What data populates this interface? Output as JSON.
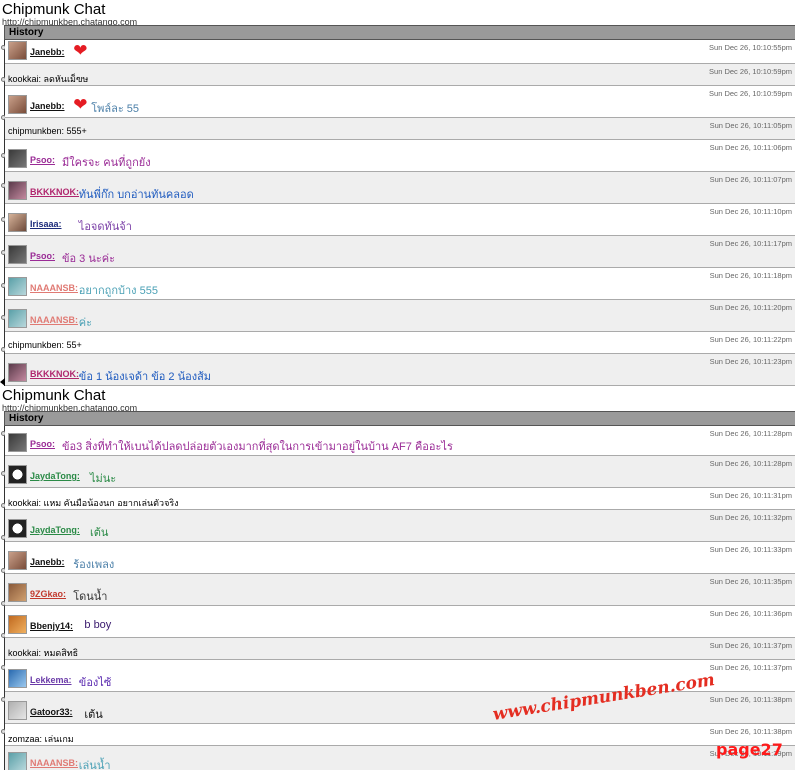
{
  "panel1": {
    "title": "Chipmunk Chat",
    "url": "http://chipmunkben.chatango.com",
    "history_label": "History",
    "messages": [
      {
        "type": "user",
        "name": "Janebb:",
        "name_color": "#111111",
        "text": "",
        "text_color": "#4b7fa8",
        "heart": true,
        "timestamp": "Sun Dec 26, 10:10:55pm",
        "avatar": "woman"
      },
      {
        "type": "anon",
        "text": "kookkai: ลดหันเม็ฃษ",
        "timestamp": "Sun Dec 26, 10:10:59pm"
      },
      {
        "type": "user",
        "name": "Janebb:",
        "name_color": "#111111",
        "text": "โพล์ละ 55",
        "text_color": "#4b7fa8",
        "heart": true,
        "timestamp": "Sun Dec 26, 10:10:59pm",
        "avatar": "woman"
      },
      {
        "type": "anon",
        "text": "chipmunkben: 555+",
        "timestamp": "Sun Dec 26, 10:11:05pm"
      },
      {
        "type": "user",
        "name": "Psoo:",
        "name_color": "#9a2b96",
        "text": "มีใครจะ คนที่ถูกยัง",
        "text_color": "#9a2b96",
        "heart": false,
        "timestamp": "Sun Dec 26, 10:11:06pm",
        "avatar": "dark"
      },
      {
        "type": "user",
        "name": "BKKKNOK:",
        "name_color": "#b0266e",
        "text": "ทันพี่ก๊ก บกอ่านทันคลอด",
        "text_color": "#1f5bbf",
        "heart": false,
        "timestamp": "Sun Dec 26, 10:11:07pm",
        "avatar": "couple"
      },
      {
        "type": "user",
        "name": "Irisaaa:",
        "name_color": "#1b2a7a",
        "text": "ไอจดทันจ้า",
        "text_color": "#7a3fa6",
        "heart": false,
        "timestamp": "Sun Dec 26, 10:11:10pm",
        "avatar": "girl"
      },
      {
        "type": "user",
        "name": "Psoo:",
        "name_color": "#9a2b96",
        "text": "ข้อ 3 นะค่ะ",
        "text_color": "#9a2b96",
        "heart": false,
        "timestamp": "Sun Dec 26, 10:11:17pm",
        "avatar": "dark"
      },
      {
        "type": "user",
        "name": "NAAANSB:",
        "name_color": "#e07a74",
        "text": "อยากถูกบ้าง 555",
        "text_color": "#4aa0b5",
        "heart": false,
        "timestamp": "Sun Dec 26, 10:11:18pm",
        "avatar": "teal"
      },
      {
        "type": "user",
        "name": "NAAANSB:",
        "name_color": "#e07a74",
        "text": "ค่ะ",
        "text_color": "#4aa0b5",
        "heart": false,
        "timestamp": "Sun Dec 26, 10:11:20pm",
        "avatar": "teal"
      },
      {
        "type": "anon",
        "text": "chipmunkben: 55+",
        "timestamp": "Sun Dec 26, 10:11:22pm"
      },
      {
        "type": "user",
        "name": "BKKKNOK:",
        "name_color": "#b0266e",
        "text": "ข้อ 1 น้องเจด้า ข้อ 2 น้องส้ม",
        "text_color": "#1f5bbf",
        "heart": false,
        "timestamp": "Sun Dec 26, 10:11:23pm",
        "avatar": "couple"
      }
    ]
  },
  "panel2": {
    "title": "Chipmunk Chat",
    "url": "http://chipmunkben.chatango.com",
    "history_label": "History",
    "messages": [
      {
        "type": "user",
        "name": "Psoo:",
        "name_color": "#9a2b96",
        "text": "ข้อ3 สิ่งที่ทำให้เบนได้ปลดปล่อยตัวเองมากที่สุดในการเข้ามาอยู่ในบ้าน AF7 คืออะไร",
        "text_color": "#9a2b96",
        "heart": false,
        "timestamp": "Sun Dec 26, 10:11:28pm",
        "avatar": "dark"
      },
      {
        "type": "user",
        "name": "JaydaTong:",
        "name_color": "#2a8a46",
        "text": "ไม่นะ",
        "text_color": "#2a8a46",
        "heart": false,
        "timestamp": "Sun Dec 26, 10:11:28pm",
        "avatar": "panda"
      },
      {
        "type": "anon",
        "text": "kookkai: แหม คันมือน้องนก อยากเล่นตัวจริง",
        "timestamp": "Sun Dec 26, 10:11:31pm"
      },
      {
        "type": "user",
        "name": "JaydaTong:",
        "name_color": "#2a8a46",
        "text": "เต้น",
        "text_color": "#2a8a46",
        "heart": false,
        "timestamp": "Sun Dec 26, 10:11:32pm",
        "avatar": "panda"
      },
      {
        "type": "user",
        "name": "Janebb:",
        "name_color": "#111111",
        "text": "ร้องเพลง",
        "text_color": "#4b7fa8",
        "heart": false,
        "timestamp": "Sun Dec 26, 10:11:33pm",
        "avatar": "woman"
      },
      {
        "type": "user",
        "name": "9ZGkao:",
        "name_color": "#c23a2e",
        "text": "โดนน้ำ",
        "text_color": "#333333",
        "heart": false,
        "timestamp": "Sun Dec 26, 10:11:35pm",
        "avatar": "brown"
      },
      {
        "type": "user",
        "name": "Bbenjy14:",
        "name_color": "#111111",
        "text": "b boy",
        "text_color": "#3a1a6e",
        "heart": false,
        "timestamp": "Sun Dec 26, 10:11:36pm",
        "avatar": "orange"
      },
      {
        "type": "anon",
        "text": "kookkai: หมดสิทธิ",
        "timestamp": "Sun Dec 26, 10:11:37pm"
      },
      {
        "type": "user",
        "name": "Lekkema:",
        "name_color": "#6a3aa8",
        "text": "ข้องไซ้",
        "text_color": "#5a2ab0",
        "heart": false,
        "timestamp": "Sun Dec 26, 10:11:37pm",
        "avatar": "blue"
      },
      {
        "type": "user",
        "name": "Gatoor33:",
        "name_color": "#111111",
        "text": "เต้น",
        "text_color": "#111111",
        "heart": false,
        "timestamp": "Sun Dec 26, 10:11:38pm",
        "avatar": "gray"
      },
      {
        "type": "anon",
        "text": "zomzaa: เล่นเกม",
        "timestamp": "Sun Dec 26, 10:11:38pm"
      },
      {
        "type": "user",
        "name": "NAAANSB:",
        "name_color": "#e07a74",
        "text": "เล่นน้ำ",
        "text_color": "#4aa0b5",
        "heart": false,
        "timestamp": "Sun Dec 26, 10:11:39pm",
        "avatar": "teal"
      }
    ]
  },
  "watermark": {
    "site": "www.chipmunkben.com",
    "page": "page27"
  },
  "colors": {
    "history_bar": "#9a9a9a",
    "alt_row": "#efefef",
    "watermark": "#e42d21"
  }
}
